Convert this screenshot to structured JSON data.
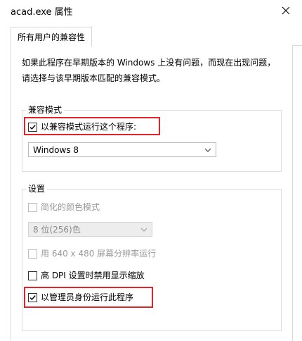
{
  "window": {
    "title": "acad.exe 属性"
  },
  "tabs": [
    {
      "label": "所有用户的兼容性"
    }
  ],
  "intro_text": "如果此程序在早期版本的 Windows 上没有问题，而现在出现问题，请选择与该早期版本匹配的兼容模式。",
  "compat_mode": {
    "group_title": "兼容模式",
    "checkbox_label": "以兼容模式运行这个程序:",
    "checked": true,
    "selected_os": "Windows 8"
  },
  "settings": {
    "group_title": "设置",
    "reduced_color": {
      "label": "简化的颜色模式",
      "checked": false,
      "enabled": false
    },
    "color_select": {
      "value": "8 位(256)色",
      "enabled": false
    },
    "low_res": {
      "label": "用 640 x 480 屏幕分辨率运行",
      "checked": false,
      "enabled": false
    },
    "high_dpi": {
      "label": "高 DPI 设置时禁用显示缩放",
      "checked": false,
      "enabled": true
    },
    "run_as_admin": {
      "label": "以管理员身份运行此程序",
      "checked": true,
      "enabled": true
    }
  },
  "colors": {
    "highlight": "#e0242a",
    "border": "#dcdcdc"
  }
}
